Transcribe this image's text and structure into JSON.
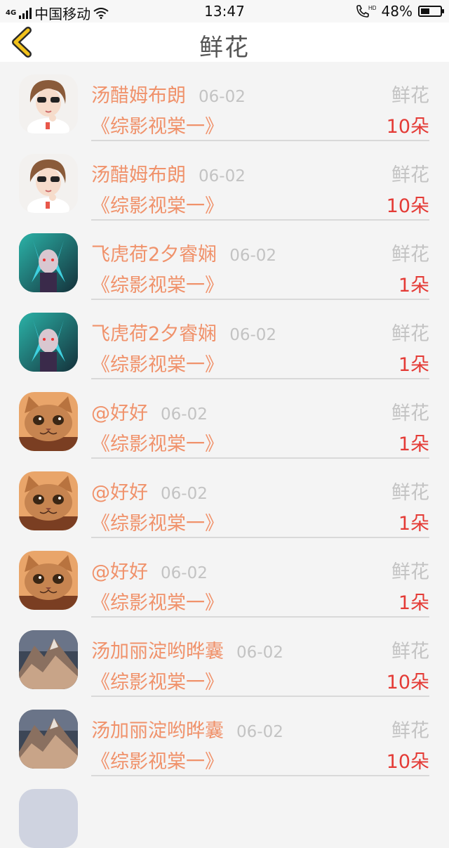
{
  "status": {
    "carrier": "中国移动",
    "network": "4G",
    "time": "13:47",
    "hd": "HD",
    "battery": "48%",
    "battery_level": 0.48
  },
  "header": {
    "title": "鲜花"
  },
  "gift_label": "鲜花",
  "rows": [
    {
      "name": "汤醋姆布朗",
      "date": "06-02",
      "work": "《综影视棠一》",
      "gift": "鲜花",
      "count": "10朵",
      "avatar": "girl-avatar"
    },
    {
      "name": "汤醋姆布朗",
      "date": "06-02",
      "work": "《综影视棠一》",
      "gift": "鲜花",
      "count": "10朵",
      "avatar": "girl-avatar"
    },
    {
      "name": "飞虎荷2夕睿娴",
      "date": "06-02",
      "work": "《综影视棠一》",
      "gift": "鲜花",
      "count": "1朵",
      "avatar": "anime-avatar"
    },
    {
      "name": "飞虎荷2夕睿娴",
      "date": "06-02",
      "work": "《综影视棠一》",
      "gift": "鲜花",
      "count": "1朵",
      "avatar": "anime-avatar"
    },
    {
      "name": "@好好",
      "date": "06-02",
      "work": "《综影视棠一》",
      "gift": "鲜花",
      "count": "1朵",
      "avatar": "cat-avatar"
    },
    {
      "name": "@好好",
      "date": "06-02",
      "work": "《综影视棠一》",
      "gift": "鲜花",
      "count": "1朵",
      "avatar": "cat-avatar"
    },
    {
      "name": "@好好",
      "date": "06-02",
      "work": "《综影视棠一》",
      "gift": "鲜花",
      "count": "1朵",
      "avatar": "cat-avatar"
    },
    {
      "name": "汤加丽淀哟晔囊",
      "date": "06-02",
      "work": "《综影视棠一》",
      "gift": "鲜花",
      "count": "10朵",
      "avatar": "mountain-avatar"
    },
    {
      "name": "汤加丽淀哟晔囊",
      "date": "06-02",
      "work": "《综影视棠一》",
      "gift": "鲜花",
      "count": "10朵",
      "avatar": "mountain-avatar"
    }
  ],
  "colors": {
    "name": "#f0926b",
    "count": "#e43b36",
    "muted": "#c3c3c3",
    "back_arrow": "#f2c21b"
  }
}
